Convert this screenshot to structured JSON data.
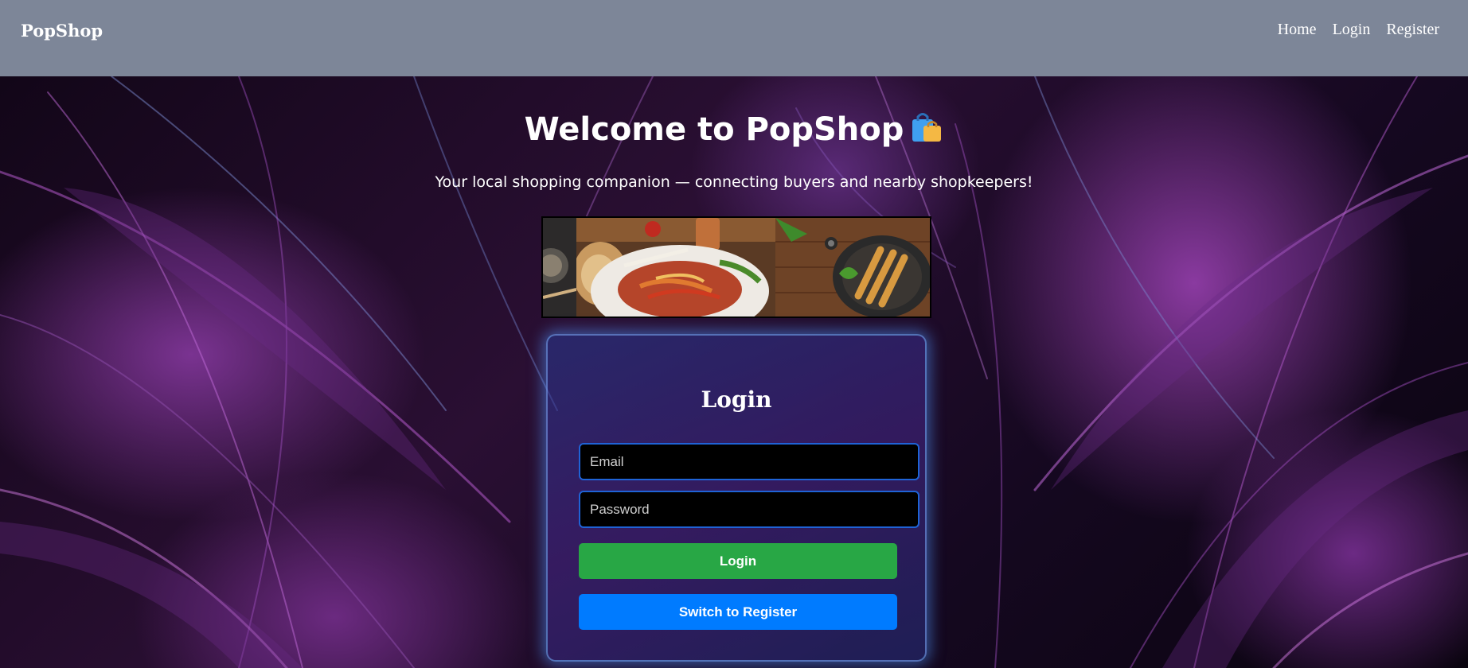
{
  "navbar": {
    "brand": "PopShop",
    "links": [
      {
        "label": "Home"
      },
      {
        "label": "Login"
      },
      {
        "label": "Register"
      }
    ]
  },
  "hero": {
    "title": "Welcome to PopShop",
    "title_icon": "shopping-bags-icon",
    "subtitle": "Your local shopping companion — connecting buyers and nearby shopkeepers!"
  },
  "banner": {
    "images": [
      "food-platter-image",
      "fajita-plate-image",
      "kebab-skewers-image"
    ]
  },
  "login_card": {
    "title": "Login",
    "email_placeholder": "Email",
    "password_placeholder": "Password",
    "login_label": "Login",
    "switch_label": "Switch to Register"
  },
  "colors": {
    "navbar_bg": "#7d8698",
    "login_button": "#28a745",
    "switch_button": "#007bff",
    "input_border": "#1f63d6"
  }
}
